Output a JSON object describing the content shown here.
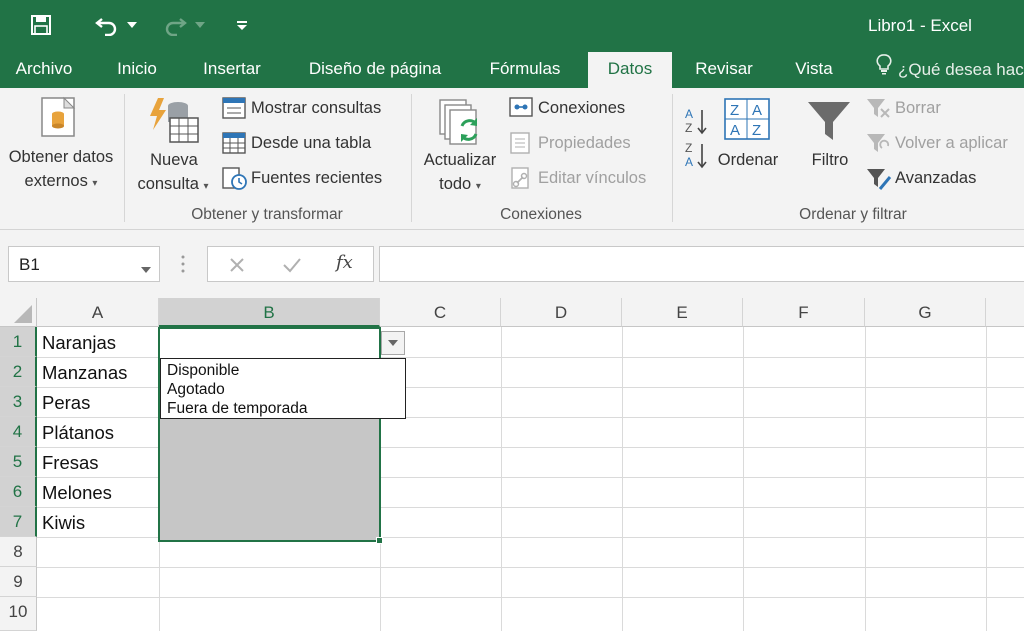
{
  "quick_access": {
    "save_icon": "save-icon",
    "undo_icon": "undo-icon",
    "redo_icon": "redo-icon",
    "customize_icon": "customize-qat-icon"
  },
  "window": {
    "title": "Libro1 - Excel"
  },
  "tabs": [
    "Archivo",
    "Inicio",
    "Insertar",
    "Diseño de página",
    "Fórmulas",
    "Datos",
    "Revisar",
    "Vista"
  ],
  "active_tab": "Datos",
  "tell_me": "¿Qué desea hac",
  "ribbon": {
    "get_external_line1": "Obtener datos",
    "get_external_line2": "externos",
    "new_query_line1": "Nueva",
    "new_query_line2": "consulta",
    "show_queries": "Mostrar consultas",
    "from_table": "Desde una tabla",
    "recent_sources": "Fuentes recientes",
    "group_get_transform": "Obtener y transformar",
    "refresh_line1": "Actualizar",
    "refresh_line2": "todo",
    "connections": "Conexiones",
    "properties": "Propiedades",
    "edit_links": "Editar vínculos",
    "group_connections": "Conexiones",
    "sort": "Ordenar",
    "filter": "Filtro",
    "clear": "Borrar",
    "reapply": "Volver a aplicar",
    "advanced": "Avanzadas",
    "group_sort_filter": "Ordenar y filtrar"
  },
  "formula_bar": {
    "name_box": "B1",
    "fx_label": "fx",
    "formula": ""
  },
  "columns": [
    "A",
    "B",
    "C",
    "D",
    "E",
    "F",
    "G"
  ],
  "selected_column": "B",
  "rows": [
    "1",
    "2",
    "3",
    "4",
    "5",
    "6",
    "7",
    "8",
    "9",
    "10"
  ],
  "selected_rows": [
    "1",
    "2",
    "3",
    "4",
    "5",
    "6",
    "7"
  ],
  "cells_a": [
    "Naranjas",
    "Manzanas",
    "Peras",
    "Plátanos",
    "Fresas",
    "Melones",
    "Kiwis"
  ],
  "dropdown": {
    "options": [
      "Disponible",
      "Agotado",
      "Fuera de temporada"
    ]
  },
  "colors": {
    "accent": "#217346",
    "ribbon_bg": "#f3f3f3",
    "selection_fill": "#c6c6c6"
  }
}
